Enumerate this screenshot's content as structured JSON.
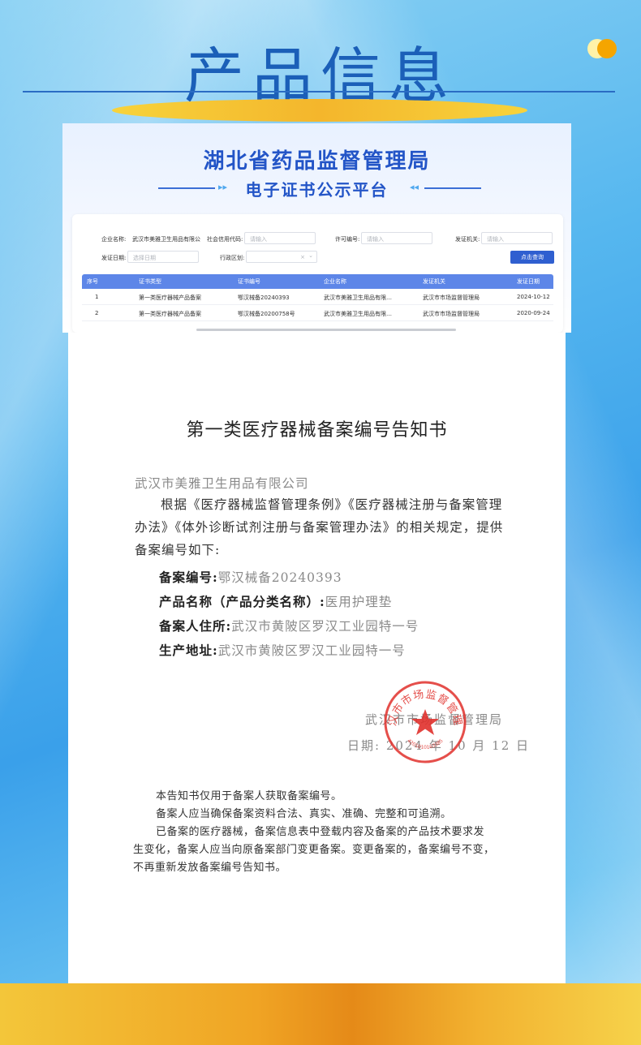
{
  "header": {
    "title": "产品信息"
  },
  "portal": {
    "title": "湖北省药品监督管理局",
    "subtitle": "电子证书公示平台",
    "filters": {
      "company_label": "企业名称:",
      "company_value": "武汉市美雅卫生用品有限公",
      "credit_label": "社会信用代码:",
      "credit_placeholder": "请输入",
      "license_label": "许可编号:",
      "license_placeholder": "请输入",
      "authority_label": "发证机关:",
      "authority_placeholder": "请输入",
      "date_label": "发证日期:",
      "date_placeholder": "选择日期",
      "region_label": "行政区划:",
      "region_clear": "×",
      "region_arrow": "⌄",
      "search_button": "点击查询"
    },
    "table": {
      "columns": [
        "序号",
        "证书类型",
        "证书编号",
        "企业名称",
        "发证机关",
        "发证日期"
      ],
      "rows": [
        [
          "1",
          "第一类医疗器械产品备案",
          "鄂汉械备20240393",
          "武汉市美雅卫生用品有限…",
          "武汉市市场监督管理局",
          "2024-10-12"
        ],
        [
          "2",
          "第一类医疗器械产品备案",
          "鄂汉械备20200758号",
          "武汉市美雅卫生用品有限…",
          "武汉市市场监督管理局",
          "2020-09-24"
        ]
      ]
    }
  },
  "notice": {
    "title": "第一类医疗器械备案编号告知书",
    "recipient": "武汉市美雅卫生用品有限公司",
    "body_line1": "根据《医疗器械监督管理条例》《医疗器械注册与备案管理",
    "body_line2": "办法》《体外诊断试剂注册与备案管理办法》的相关规定，提供",
    "body_line3": "备案编号如下:",
    "fields": [
      {
        "key": "备案编号:",
        "value": "鄂汉械备20240393"
      },
      {
        "key": "产品名称（产品分类名称）:",
        "value": "医用护理垫"
      },
      {
        "key": "备案人住所:",
        "value": "武汉市黄陂区罗汉工业园特一号"
      },
      {
        "key": "生产地址:",
        "value": "武汉市黄陂区罗汉工业园特一号"
      }
    ],
    "issuer": "武汉市市场监督管理局",
    "date_line": "日期: 2024 年 10 月 12 日",
    "seal_text": "武汉市市场监督管理局",
    "seal_code": "4201010163385",
    "footer_line1": "本告知书仅用于备案人获取备案编号。",
    "footer_line2": "备案人应当确保备案资料合法、真实、准确、完整和可追溯。",
    "footer_line3": "已备案的医疗器械，备案信息表中登载内容及备案的产品技术要求发",
    "footer_line4": "生变化，备案人应当向原备案部门变更备案。变更备案的，备案编号不变，",
    "footer_line5": "不再重新发放备案编号告知书。"
  },
  "colors": {
    "title_blue": "#1b5fb8",
    "portal_blue": "#2355c7",
    "table_header": "#5d86e8",
    "button": "#2f5fd0",
    "seal_red": "#e0302b",
    "accent_gold": "#f4b62c"
  }
}
